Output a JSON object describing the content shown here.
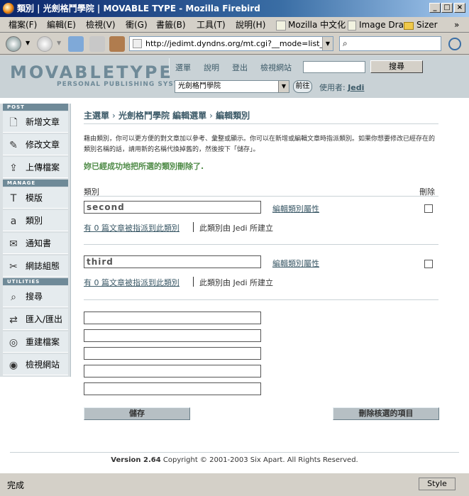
{
  "window": {
    "title": "類別 | 光劍格鬥學院 | MOVABLE TYPE - Mozilla Firebird"
  },
  "menubar": {
    "items": [
      "檔案(F)",
      "編輯(E)",
      "檢視(V)",
      "衝(G)",
      "書籤(B)",
      "工具(T)",
      "說明(H)"
    ],
    "extras": [
      "Mozilla 中文化",
      "Image Drag",
      "Sizer",
      "»"
    ]
  },
  "navbar": {
    "url": "http://jedimt.dyndns.org/mt.cgi?__mode=list_cat&b"
  },
  "mt_header": {
    "logo": "MOVABLETYPE",
    "tagline": "PERSONAL PUBLISHING SYSTEM",
    "links": [
      "選單",
      "說明",
      "登出",
      "檢視網站"
    ],
    "search_button": "搜尋",
    "blog_select": "光劍格鬥學院",
    "go_button": "前往",
    "user_label": "使用者:",
    "user_name": "Jedi"
  },
  "sidebar": {
    "sections": [
      {
        "title": "POST",
        "items": [
          {
            "label": "新增文章",
            "icon": "new-entry-icon"
          },
          {
            "label": "修改文章",
            "icon": "edit-entries-icon"
          },
          {
            "label": "上傳檔案",
            "icon": "upload-file-icon"
          }
        ]
      },
      {
        "title": "MANAGE",
        "items": [
          {
            "label": "模版",
            "icon": "templates-icon"
          },
          {
            "label": "類別",
            "icon": "categories-icon"
          },
          {
            "label": "通知書",
            "icon": "notifications-icon"
          },
          {
            "label": "網誌組態",
            "icon": "weblog-config-icon"
          }
        ]
      },
      {
        "title": "UTILITIES",
        "items": [
          {
            "label": "搜尋",
            "icon": "search-icon"
          },
          {
            "label": "匯入/匯出",
            "icon": "import-export-icon"
          },
          {
            "label": "重建檔案",
            "icon": "rebuild-icon"
          },
          {
            "label": "檢視網站",
            "icon": "view-site-icon"
          }
        ]
      }
    ]
  },
  "main": {
    "breadcrumb": [
      "主選單",
      "光劍格鬥學院 編輯選單",
      "編輯類別"
    ],
    "description": "藉由類別，你可以更方便的對文章加以參考、彙整或顯示。你可以在新增或編輯文章時指派類別。如果你想要修改已經存在的類別名稱的話，請用新的名稱代換掉舊的，然後按下「儲存」。",
    "success": "妳已經成功地把所選的類別刪除了.",
    "col_category": "類別",
    "col_delete": "刪除",
    "categories": [
      {
        "name": "second",
        "edit_link": "編輯類別屬性",
        "assigned": "有 0 篇文章被指派到此類別",
        "created_by": "此類別由 Jedi 所建立"
      },
      {
        "name": "third",
        "edit_link": "編輯類別屬性",
        "assigned": "有 0 篇文章被指派到此類別",
        "created_by": "此類別由 Jedi 所建立"
      }
    ],
    "save_button": "儲存",
    "delete_button": "刪除核選的項目"
  },
  "footer": {
    "version": "Version 2.64",
    "copyright": "Copyright © 2001-2003 Six Apart. All Rights Reserved."
  },
  "statusbar": {
    "text": "完成",
    "style_button": "Style"
  }
}
